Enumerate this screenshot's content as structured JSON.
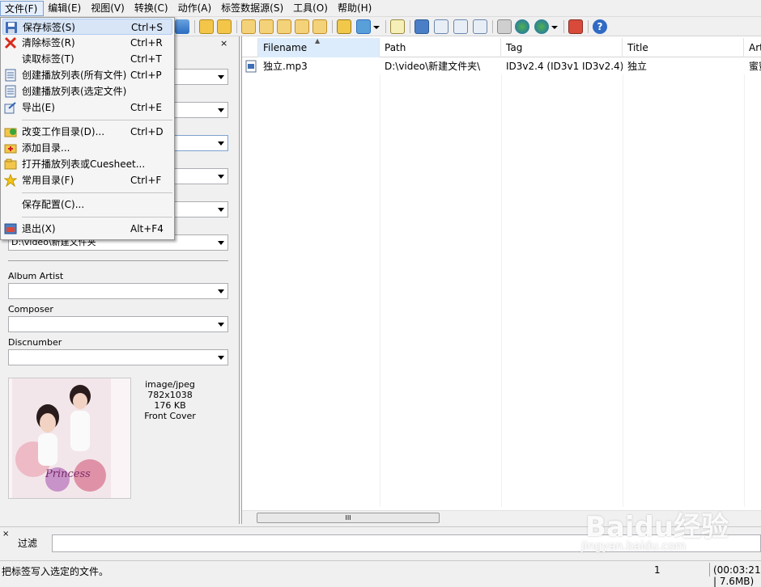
{
  "menubar": {
    "items": [
      "文件(F)",
      "编辑(E)",
      "视图(V)",
      "转换(C)",
      "动作(A)",
      "标签数据源(S)",
      "工具(O)",
      "帮助(H)"
    ]
  },
  "file_menu": {
    "items": [
      {
        "label": "保存标签(S)",
        "shortcut": "Ctrl+S",
        "icon": "save-icon"
      },
      {
        "label": "清除标签(R)",
        "shortcut": "Ctrl+R",
        "icon": "remove-x-icon"
      },
      {
        "label": "读取标签(T)",
        "shortcut": "Ctrl+T",
        "icon": ""
      },
      {
        "label": "创建播放列表(所有文件)",
        "shortcut": "Ctrl+P",
        "icon": "playlist-icon"
      },
      {
        "label": "创建播放列表(选定文件)",
        "shortcut": "",
        "icon": "playlist-icon"
      },
      {
        "label": "导出(E)",
        "shortcut": "Ctrl+E",
        "icon": "export-icon"
      },
      {
        "label": "改变工作目录(D)...",
        "shortcut": "Ctrl+D",
        "icon": "folder-check-icon"
      },
      {
        "label": "添加目录...",
        "shortcut": "",
        "icon": "folder-add-icon"
      },
      {
        "label": "打开播放列表或Cuesheet...",
        "shortcut": "",
        "icon": "folder-open-icon"
      },
      {
        "label": "常用目录(F)",
        "shortcut": "Ctrl+F",
        "icon": "star-icon"
      },
      {
        "label": "保存配置(C)...",
        "shortcut": "",
        "icon": ""
      },
      {
        "label": "退出(X)",
        "shortcut": "Alt+F4",
        "icon": "exit-icon"
      }
    ]
  },
  "left_panel": {
    "close_glyph": "×",
    "path_value": "D:\\video\\新建文件夹",
    "album_artist_label": "Album Artist",
    "composer_label": "Composer",
    "discnumber_label": "Discnumber",
    "cover": {
      "mime": "image/jpeg",
      "size": "782x1038",
      "bytes": "176 KB",
      "type": "Front Cover",
      "art_text": "Princess"
    }
  },
  "file_list": {
    "columns": [
      "Filename",
      "Path",
      "Tag",
      "Title",
      "Art"
    ],
    "rows": [
      {
        "filename": "独立.mp3",
        "path": "D:\\video\\新建文件夹\\",
        "tag": "ID3v2.4 (ID3v1 ID3v2.4)",
        "title": "独立",
        "artist": "蜜蜜"
      }
    ]
  },
  "filter": {
    "label": "过滤",
    "close_glyph": "×"
  },
  "status": {
    "text": "把标签写入选定的文件。",
    "count": "1",
    "time": "(00:03:21 | 7.6MB)"
  },
  "scrollbar": {
    "grip": "III"
  },
  "watermark": {
    "main": "Baidu经验",
    "sub": "jingyan.baidu.com"
  },
  "colors": {
    "menu_highlight": "#d7e5f7",
    "selected_header": "#dcecfc"
  }
}
